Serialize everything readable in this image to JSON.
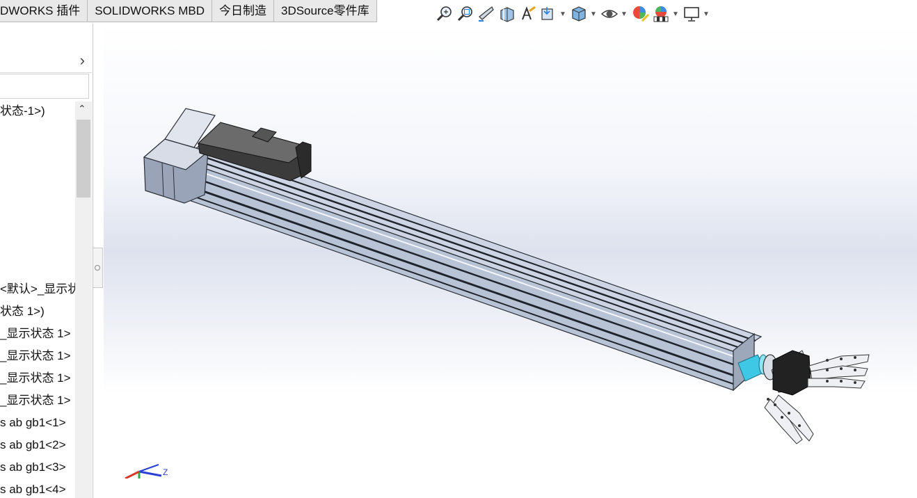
{
  "tabs": [
    "DWORKS 插件",
    "SOLIDWORKS MBD",
    "今日制造",
    "3DSource零件库"
  ],
  "toolbar": {
    "buttons": [
      {
        "icon": "zoom-to-fit-icon"
      },
      {
        "icon": "zoom-to-area-icon"
      },
      {
        "icon": "previous-view-icon"
      },
      {
        "icon": "section-view-icon"
      },
      {
        "icon": "dynamic-annotation-icon"
      },
      {
        "icon": "view-orientation-icon",
        "dropdown": true
      },
      {
        "icon": "display-style-icon",
        "dropdown": true
      },
      {
        "icon": "hide-show-items-icon",
        "dropdown": true
      },
      {
        "icon": "edit-appearance-icon"
      },
      {
        "icon": "apply-scene-icon",
        "dropdown": true
      },
      {
        "icon": "view-settings-icon",
        "dropdown": true
      }
    ]
  },
  "tree": {
    "lines": [
      "状态-1>)",
      "<默认>_显示状",
      "状态 1>)",
      "_显示状态 1>",
      "_显示状态 1>",
      "_显示状态 1>",
      "_显示状态 1>",
      "s ab gb1<1>",
      "s ab gb1<2>",
      "s ab gb1<3>",
      "s ab gb1<4>"
    ]
  },
  "triad": {
    "z_label": "Z"
  },
  "colors": {
    "rail": "#bcc6d8",
    "rail_dark": "#1e232c",
    "motor": "#3b3b3b",
    "coupling": "#3ec8e6"
  }
}
